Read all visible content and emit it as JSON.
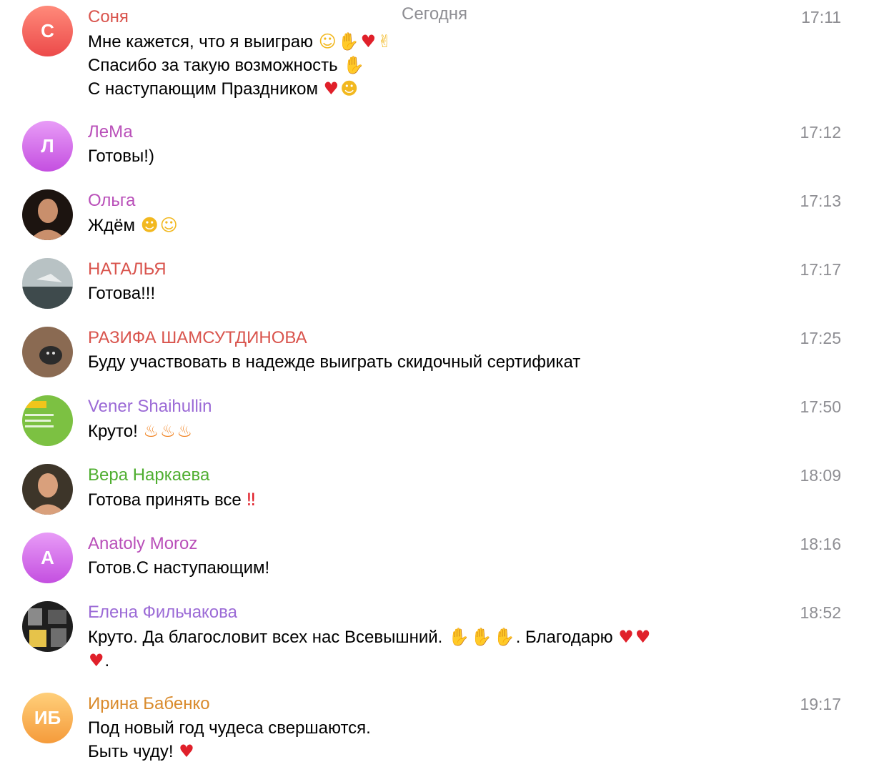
{
  "date_header": "Сегодня",
  "messages": [
    {
      "sender": "Соня",
      "sender_color": "#d9544d",
      "time": "17:11",
      "avatar": {
        "type": "initials",
        "initials": "С",
        "gradient": [
          "#ff8a7a",
          "#ec4a4a"
        ]
      },
      "lines": [
        {
          "text": "Мне кажется, что я выиграю",
          "emojis": [
            "smiling-face-emoji",
            "folded-hands-emoji",
            "red-heart-emoji",
            "thumbs-up-emoji"
          ]
        },
        {
          "text": "Спасибо за такую возможность",
          "emojis": [
            "folded-hands-emoji"
          ]
        },
        {
          "text": "С наступающим Праздником",
          "emojis": [
            "red-heart-emoji",
            "face-blowing-kiss-emoji"
          ]
        }
      ]
    },
    {
      "sender": "ЛеМа",
      "sender_color": "#b94fb9",
      "time": "17:12",
      "avatar": {
        "type": "initials",
        "initials": "Л",
        "gradient": [
          "#e89cf7",
          "#c44fe0"
        ]
      },
      "lines": [
        {
          "text": "Готовы!)",
          "emojis": []
        }
      ]
    },
    {
      "sender": "Ольга",
      "sender_color": "#b94fb9",
      "time": "17:13",
      "avatar": {
        "type": "photo",
        "photo": "portrait-photo-icon",
        "colors": [
          "#1c1410",
          "#c98f6c"
        ]
      },
      "lines": [
        {
          "text": "Ждём",
          "emojis": [
            "partying-face-emoji",
            "star-struck-emoji"
          ]
        }
      ]
    },
    {
      "sender": "НАТАЛЬЯ",
      "sender_color": "#d9544d",
      "time": "17:17",
      "avatar": {
        "type": "photo",
        "photo": "seascape-photo-icon",
        "colors": [
          "#b8c2c4",
          "#3e4a4c"
        ]
      },
      "lines": [
        {
          "text": "Готова!!!",
          "emojis": []
        }
      ]
    },
    {
      "sender": "РАЗИФА ШАМСУТДИНОВА",
      "sender_color": "#d9544d",
      "time": "17:25",
      "avatar": {
        "type": "photo",
        "photo": "cat-photo-icon",
        "colors": [
          "#8a6a52",
          "#2b2b2b"
        ]
      },
      "lines": [
        {
          "text": "Буду участвовать в надежде выиграть скидочный сертификат",
          "emojis": []
        }
      ]
    },
    {
      "sender": "Vener Shaihullin",
      "sender_color": "#9b6ad6",
      "time": "17:50",
      "avatar": {
        "type": "photo",
        "photo": "green-banner-photo-icon",
        "colors": [
          "#7cc142",
          "#f1c51b"
        ]
      },
      "lines": [
        {
          "text": "Круто!",
          "emojis": [
            "fire-emoji",
            "fire-emoji",
            "fire-emoji"
          ]
        }
      ]
    },
    {
      "sender": "Вера Наркаева",
      "sender_color": "#4fae30",
      "time": "18:09",
      "avatar": {
        "type": "photo",
        "photo": "woman-portrait-photo-icon",
        "colors": [
          "#3d3529",
          "#d9a07c"
        ]
      },
      "lines": [
        {
          "text": "Готова принять все",
          "emojis": [
            "double-exclamation-emoji"
          ]
        }
      ]
    },
    {
      "sender": "Anatoly Moroz",
      "sender_color": "#b94fb9",
      "time": "18:16",
      "avatar": {
        "type": "initials",
        "initials": "А",
        "gradient": [
          "#e89cf7",
          "#c44fe0"
        ]
      },
      "lines": [
        {
          "text": "Готов.С наступающим!",
          "emojis": []
        }
      ]
    },
    {
      "sender": "Елена Фильчакова",
      "sender_color": "#9b6ad6",
      "time": "18:52",
      "avatar": {
        "type": "photo",
        "photo": "collage-photo-icon",
        "colors": [
          "#1e1e1e",
          "#e6c34a"
        ]
      },
      "lines": [
        {
          "text": "Круто. Да благословит всех нас Всевышний.",
          "emojis": [
            "raising-hands-emoji",
            "raising-hands-emoji",
            "raising-hands-emoji"
          ],
          "suffix": ". Благодарю",
          "suffix_emojis": [
            "red-heart-emoji",
            "red-heart-emoji"
          ]
        },
        {
          "text": "",
          "emojis": [
            "red-heart-emoji"
          ],
          "suffix": "."
        }
      ]
    },
    {
      "sender": "Ирина Бабенко",
      "sender_color": "#d98a2b",
      "time": "19:17",
      "avatar": {
        "type": "initials",
        "initials": "ИБ",
        "gradient": [
          "#ffcf7a",
          "#f59b3b"
        ]
      },
      "lines": [
        {
          "text": "Под новый год чудеса свершаются.",
          "emojis": []
        },
        {
          "text": "Быть чуду!",
          "emojis": [
            "red-heart-emoji"
          ]
        }
      ]
    }
  ]
}
